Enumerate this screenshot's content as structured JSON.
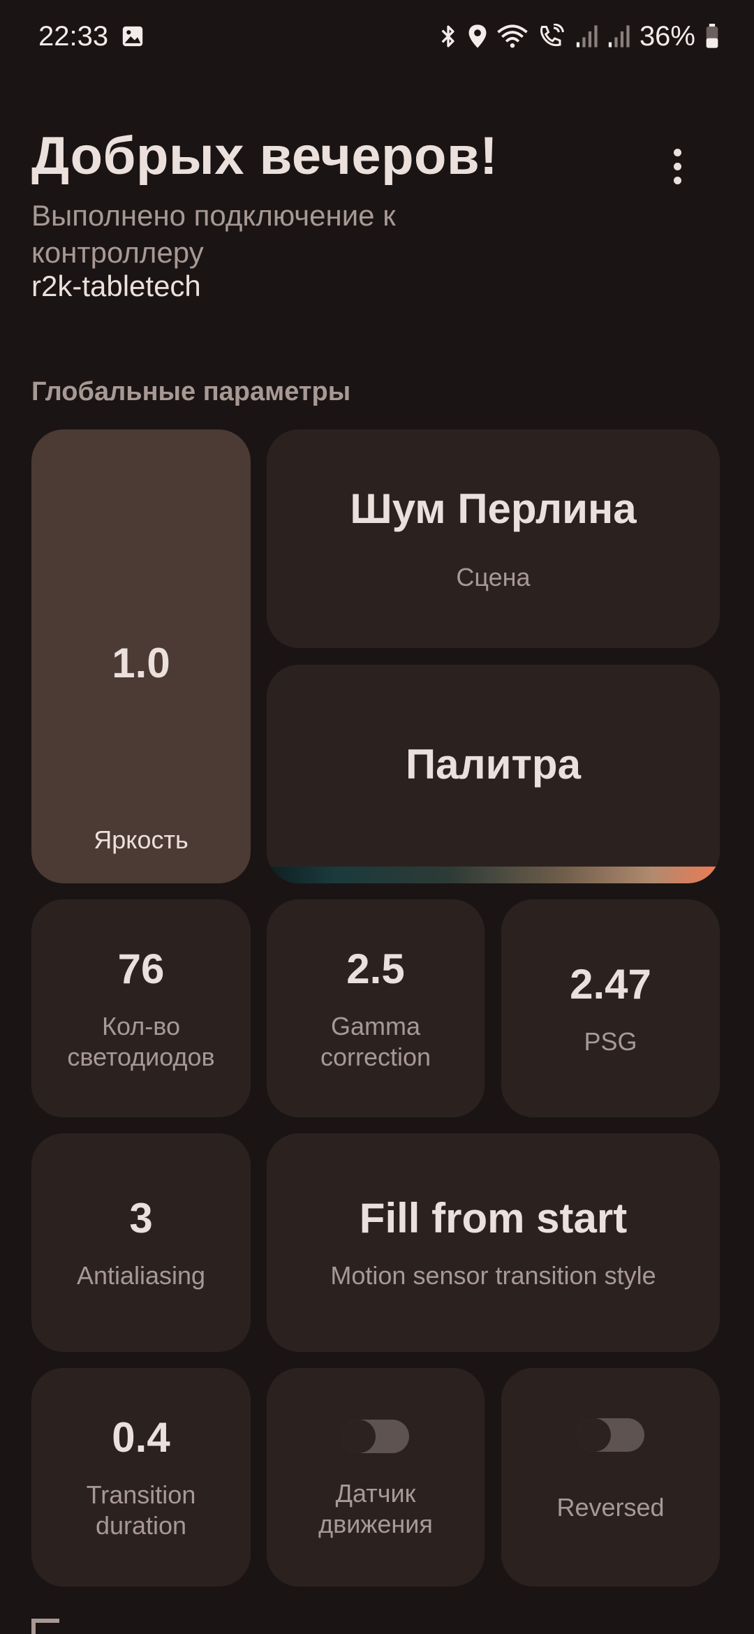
{
  "status_bar": {
    "time": "22:33",
    "battery_percent": "36%",
    "icons": [
      "image-icon",
      "bluetooth-icon",
      "location-icon",
      "wifi-icon",
      "wifi-calling-icon",
      "signal-icon",
      "signal-icon",
      "battery-icon"
    ]
  },
  "header": {
    "greeting": "Добрых вечеров!",
    "subtitle": "Выполнено подключение к контроллеру",
    "controller_name": "r2k-tabletech",
    "menu_icon": "more-vert-icon"
  },
  "global_params": {
    "title": "Глобальные параметры",
    "brightness": {
      "value": "1.0",
      "label": "Яркость"
    },
    "scene": {
      "value": "Шум Перлина",
      "label": "Сцена"
    },
    "palette": {
      "value": "Палитра"
    },
    "led_count": {
      "value": "76",
      "label": "Кол-во светодиодов"
    },
    "gamma": {
      "value": "2.5",
      "label": "Gamma correction"
    },
    "psg": {
      "value": "2.47",
      "label": "PSG"
    },
    "antialiasing": {
      "value": "3",
      "label": "Antialiasing"
    },
    "transition_style": {
      "value": "Fill from start",
      "label": "Motion sensor transition style"
    },
    "transition_duration": {
      "value": "0.4",
      "label": "Transition duration"
    },
    "motion_sensor": {
      "label": "Датчик движения",
      "enabled": false
    },
    "reversed": {
      "label": "Reversed",
      "enabled": false
    }
  },
  "colors": {
    "background": "#1a1514",
    "tile": "#2b2220",
    "brightness_tile": "#4c3b35",
    "text_primary": "#ece0dc",
    "text_secondary": "#a89994"
  }
}
